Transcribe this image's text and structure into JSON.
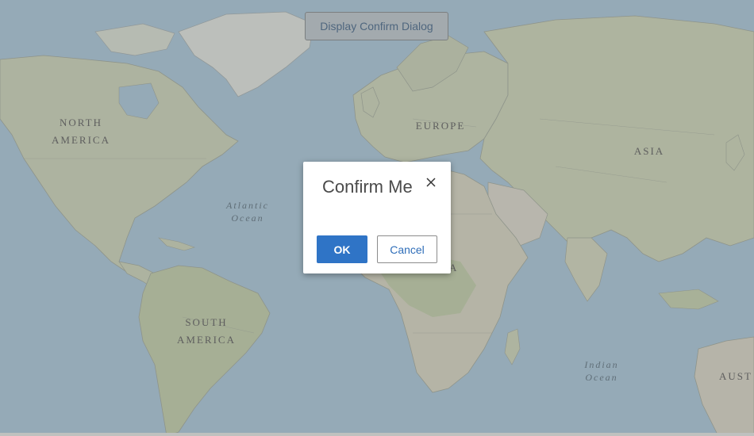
{
  "map": {
    "labels": {
      "north_america": "NORTH\nAMERICA",
      "europe": "EUROPE",
      "asia": "ASIA",
      "atlantic_ocean": "Atlantic\nOcean",
      "south_america": "SOUTH\nAMERICA",
      "africa_partial": "A",
      "indian_ocean": "Indian\nOcean",
      "australia_partial": "AUST"
    },
    "colors": {
      "ocean": "#9cbfd6",
      "land": "#c9d3b4",
      "forest": "#b6c79a",
      "desert": "#d8d4c4",
      "border": "#8e958d"
    }
  },
  "toolbar": {
    "display_confirm_label": "Display Confirm Dialog"
  },
  "dialog": {
    "title": "Confirm Me",
    "close_icon": "close-icon",
    "ok_label": "OK",
    "cancel_label": "Cancel",
    "colors": {
      "primary": "#2f74c6",
      "link": "#2f6eb9"
    }
  }
}
